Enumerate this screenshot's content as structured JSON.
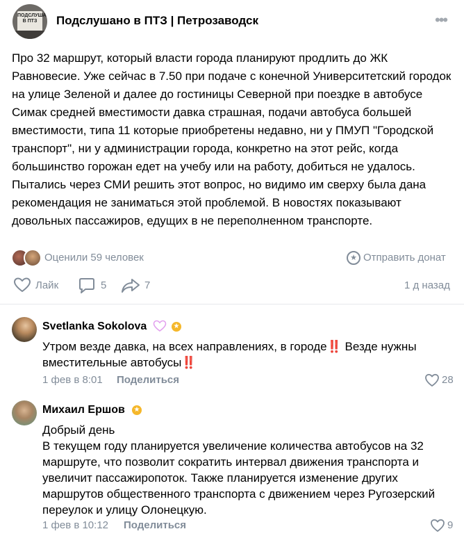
{
  "post": {
    "group_logo_text": "ПОДСЛУШАНО В ПТЗ",
    "group_name": "Подслушано в ПТЗ | Петрозаводск",
    "text": "Про 32 маршрут, который власти города планируют продлить до ЖК Равновесие. Уже сейчас в 7.50 при подаче с конечной Университетский городок на улице Зеленой и далее до гостиницы Северной при поездке в автобусе Симак средней вместимости давка страшная, подачи автобуса большей вместимости, типа 11 которые приобретены недавно, ни у ПМУП \"Городской транспорт\", ни у администрации города, конкретно на этот рейс, когда большинство горожан едет на учебу или на работу, добиться не удалось. Пытались через СМИ решить этот вопрос, но видимо им сверху была дана рекомендация не заниматься этой проблемой. В новостях показывают довольных пассажиров, едущих в не переполненном транспорте.",
    "rated_text": "Оценили 59 человек",
    "donate_label": "Отправить донат",
    "like_label": "Лайк",
    "comments_count": "5",
    "shares_count": "7",
    "time": "1 д назад"
  },
  "comments": [
    {
      "author": "Svetlanka Sokolova",
      "text_part1": "Утром везде давка, на всех направлениях, в городе",
      "emoji1": "‼️",
      "text_part2": " Везде нужны вместительные автобусы",
      "emoji2": "‼️",
      "date": "1 фев в 8:01",
      "share_label": "Поделиться",
      "likes": "28"
    },
    {
      "author": "Михаил Ершов",
      "greeting": "Добрый день",
      "text": "В текущем году планируется увеличение количества автобусов на 32 маршруте, что позволит сократить интервал движения транспорта и увеличит пассажиропоток. Также планируется изменение других маршрутов общественного транспорта с движением через Ругозерский переулок и улицу Олонецкую.",
      "date": "1 фев в 10:12",
      "share_label": "Поделиться",
      "likes": "9"
    }
  ],
  "colors": {
    "secondary_text": "#818c99",
    "badge_star": "#f5b72a",
    "divider": "#e7e8ec"
  },
  "icons": [
    "more-icon",
    "star-badge-icon",
    "heart-icon",
    "comment-icon",
    "share-icon",
    "donate-icon"
  ]
}
